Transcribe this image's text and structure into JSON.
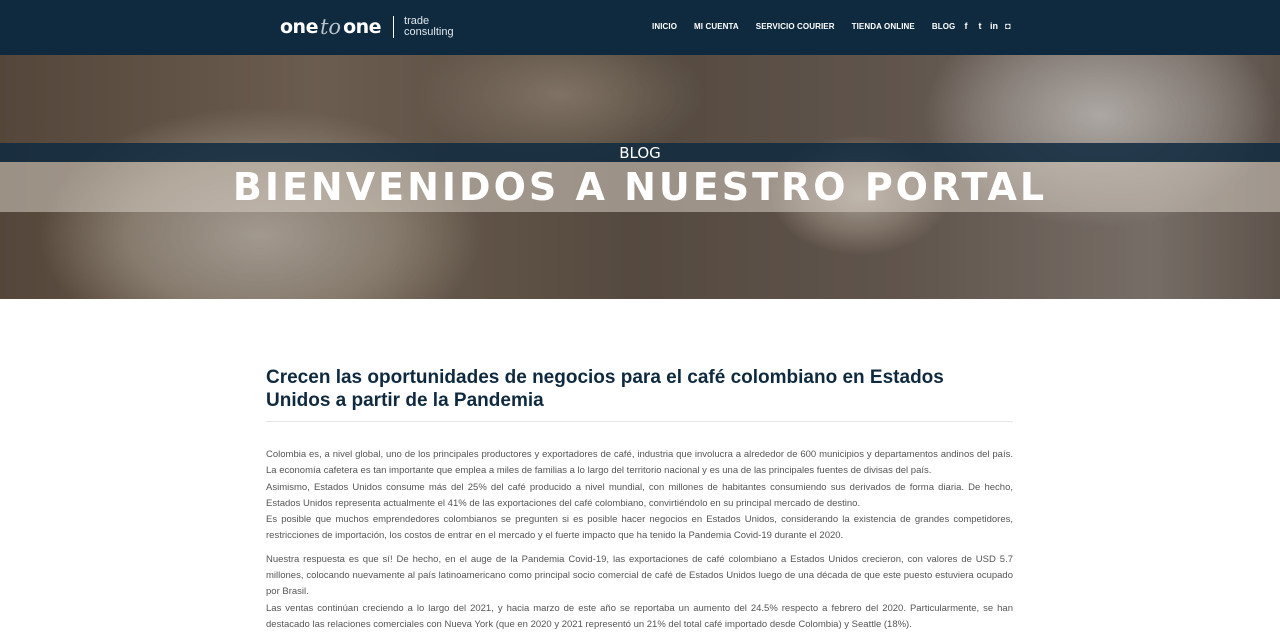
{
  "header": {
    "logo": {
      "one_left": "one",
      "to": "to",
      "one_right": "one",
      "tagline_1": "trade",
      "tagline_2": "consulting"
    },
    "nav": [
      "INICIO",
      "MI CUENTA",
      "SERVICIO COURIER",
      "TIENDA ONLINE",
      "BLOG"
    ],
    "social": [
      {
        "icon": "facebook-icon",
        "glyph": "f"
      },
      {
        "icon": "twitter-icon",
        "glyph": "t"
      },
      {
        "icon": "linkedin-icon",
        "glyph": "in"
      },
      {
        "icon": "instagram-icon",
        "glyph": "◘"
      }
    ]
  },
  "hero": {
    "label": "BLOG",
    "title": "BIENVENIDOS A NUESTRO PORTAL"
  },
  "article": {
    "title": "Crecen las oportunidades de negocios para el café colombiano en Estados Unidos a partir de la Pandemia",
    "paragraphs": [
      "Colombia es, a nivel global, uno de los principales productores y exportadores de café, industria que involucra a alrededor de 600 municipios y departamentos andinos del país. La economía cafetera es tan importante que emplea a miles de familias a lo largo del territorio nacional y es una de las principales fuentes de divisas del país.",
      "Asimismo, Estados Unidos consume más del 25% del café producido a nivel mundial, con millones de habitantes consumiendo sus derivados de forma diaria. De hecho, Estados Unidos representa actualmente el 41% de las exportaciones del café colombiano, convirtiéndolo en su principal mercado de destino.",
      "Es posible que muchos emprendedores colombianos se pregunten si es posible hacer negocios en Estados Unidos, considerando la existencia de grandes competidores, restricciones de importación, los costos de entrar en el mercado y el fuerte impacto que ha tenido la Pandemia Covid-19 durante el 2020.",
      "Nuestra respuesta es que sí! De hecho, en el auge de la Pandemia Covid-19, las exportaciones de café colombiano a Estados Unidos crecieron, con valores de USD 5.7 millones, colocando nuevamente al país latinoamericano como principal socio comercial de café de Estados Unidos luego de una década de que este puesto estuviera ocupado por Brasil.",
      "Las ventas continúan creciendo a lo largo del 2021, y hacia marzo de este año se reportaba un aumento del 24.5% respecto a febrero del 2020. Particularmente, se han destacado las relaciones comerciales con Nueva York (que en 2020 y 2021 representó un 21% del total café importado desde Colombia) y Seattle (18%)."
    ]
  },
  "colors": {
    "header_bg": "#0f2a3f",
    "title_color": "#0f2a3f",
    "text_color": "#555555"
  }
}
